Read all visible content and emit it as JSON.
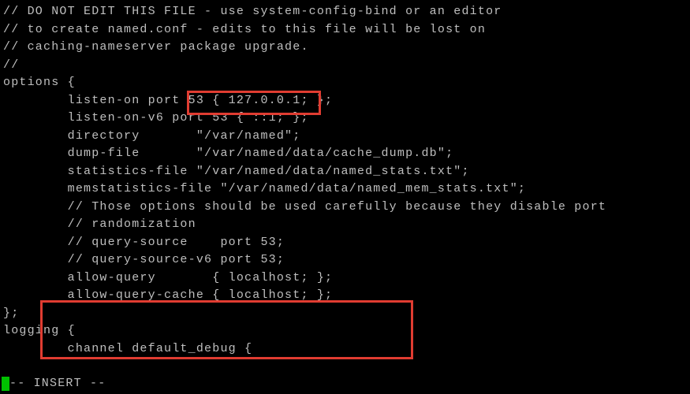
{
  "lines": [
    "// DO NOT EDIT THIS FILE - use system-config-bind or an editor",
    "// to create named.conf - edits to this file will be lost on",
    "// caching-nameserver package upgrade.",
    "//",
    "options {",
    "        listen-on port 53 { 127.0.0.1; };",
    "        listen-on-v6 port 53 { ::1; };",
    "        directory       \"/var/named\";",
    "        dump-file       \"/var/named/data/cache_dump.db\";",
    "        statistics-file \"/var/named/data/named_stats.txt\";",
    "        memstatistics-file \"/var/named/data/named_mem_stats.txt\";",
    "",
    "        // Those options should be used carefully because they disable port",
    "        // randomization",
    "        // query-source    port 53;",
    "        // query-source-v6 port 53;",
    "",
    "        allow-query       { localhost; };",
    "        allow-query-cache { localhost; };",
    "};",
    "logging {",
    "        channel default_debug {"
  ],
  "mode": "-- INSERT --"
}
